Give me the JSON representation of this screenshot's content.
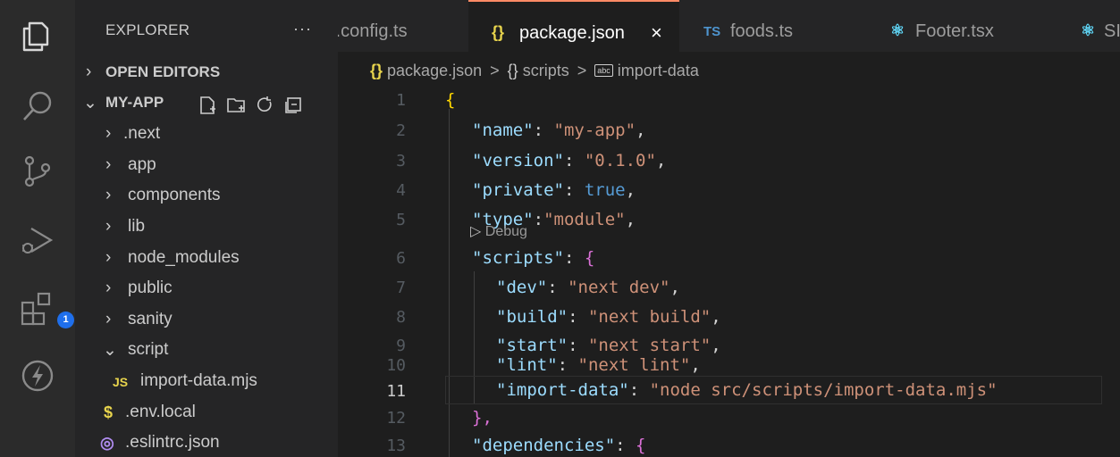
{
  "sidebar": {
    "header": "EXPLORER",
    "more": "···",
    "open_editors": "OPEN EDITORS",
    "project": "MY-APP",
    "tree": [
      {
        "label": ".next",
        "chev": "›"
      },
      {
        "label": "app",
        "chev": "›"
      },
      {
        "label": "components",
        "chev": "›"
      },
      {
        "label": "lib",
        "chev": "›"
      },
      {
        "label": "node_modules",
        "chev": "›"
      },
      {
        "label": "public",
        "chev": "›"
      },
      {
        "label": "sanity",
        "chev": "›"
      },
      {
        "label": "script",
        "chev": "⌄"
      }
    ],
    "files": [
      {
        "icon": "JS",
        "label": "import-data.mjs"
      },
      {
        "icon": "$",
        "label": ".env.local"
      },
      {
        "icon": "◎",
        "label": ".eslintrc.json"
      }
    ]
  },
  "activity": {
    "extensions_badge": "1"
  },
  "tabs": [
    {
      "icon": "",
      "label": "/.config.ts"
    },
    {
      "icon": "{}",
      "label": "package.json",
      "close": "×"
    },
    {
      "icon": "TS",
      "label": "foods.ts"
    },
    {
      "icon": "⚛",
      "label": "Footer.tsx"
    },
    {
      "icon": "⚛",
      "label": "SI"
    }
  ],
  "breadcrumb": {
    "file_icon": "{}",
    "file": "package.json",
    "sep": ">",
    "node_icon": "{}",
    "node": "scripts",
    "leaf_icon": "abc",
    "leaf": "import-data"
  },
  "editor": {
    "codelens": "Debug",
    "lines": [
      {
        "n": "1",
        "code": "{"
      },
      {
        "n": "2",
        "key": "\"name\"",
        "val": "\"my-app\"",
        "end": ","
      },
      {
        "n": "3",
        "key": "\"version\"",
        "val": "\"0.1.0\"",
        "end": ","
      },
      {
        "n": "4",
        "key": "\"private\"",
        "val": "true",
        "end": ","
      },
      {
        "n": "5",
        "key": "\"type\"",
        "val": "\"module\"",
        "end": ","
      },
      {
        "n": "6",
        "key": "\"scripts\"",
        "val": "{"
      },
      {
        "n": "7",
        "key": "\"dev\"",
        "val": "\"next dev\"",
        "end": ","
      },
      {
        "n": "8",
        "key": "\"build\"",
        "val": "\"next build\"",
        "end": ","
      },
      {
        "n": "9",
        "key": "\"start\"",
        "val": "\"next start\"",
        "end": ","
      },
      {
        "n": "10",
        "key": "\"lint\"",
        "val": "\"next lint\"",
        "end": ","
      },
      {
        "n": "11",
        "key": "\"import-data\"",
        "val": "\"node src/scripts/import-data.mjs\""
      },
      {
        "n": "12",
        "code": "},"
      },
      {
        "n": "13",
        "key": "\"dependencies\"",
        "val": "{"
      }
    ]
  },
  "colors": {
    "accent_tab": "#ff8a65",
    "badge": "#1f6feb"
  }
}
